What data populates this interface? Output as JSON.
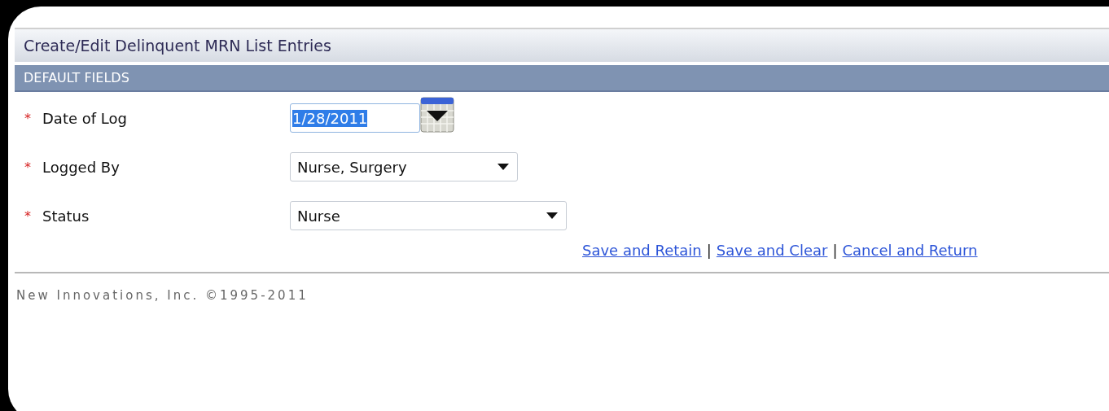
{
  "page_title": "Create/Edit Delinquent MRN List Entries",
  "section": {
    "title": "DEFAULT FIELDS"
  },
  "fields": [
    {
      "kind": "date",
      "label": "Date of Log",
      "required": true,
      "value": "1/28/2011",
      "highlighted": true
    },
    {
      "kind": "select",
      "label": "Logged By",
      "required": true,
      "value": "Nurse, Surgery"
    },
    {
      "kind": "select",
      "label": "Status",
      "required": true,
      "value": "Nurse"
    }
  ],
  "required_mark": "*",
  "link_separator": "|",
  "links": [
    "Save and Retain",
    "Save and Clear",
    "Cancel and Return"
  ],
  "footer": "New Innovations, Inc. ©1995-2011"
}
